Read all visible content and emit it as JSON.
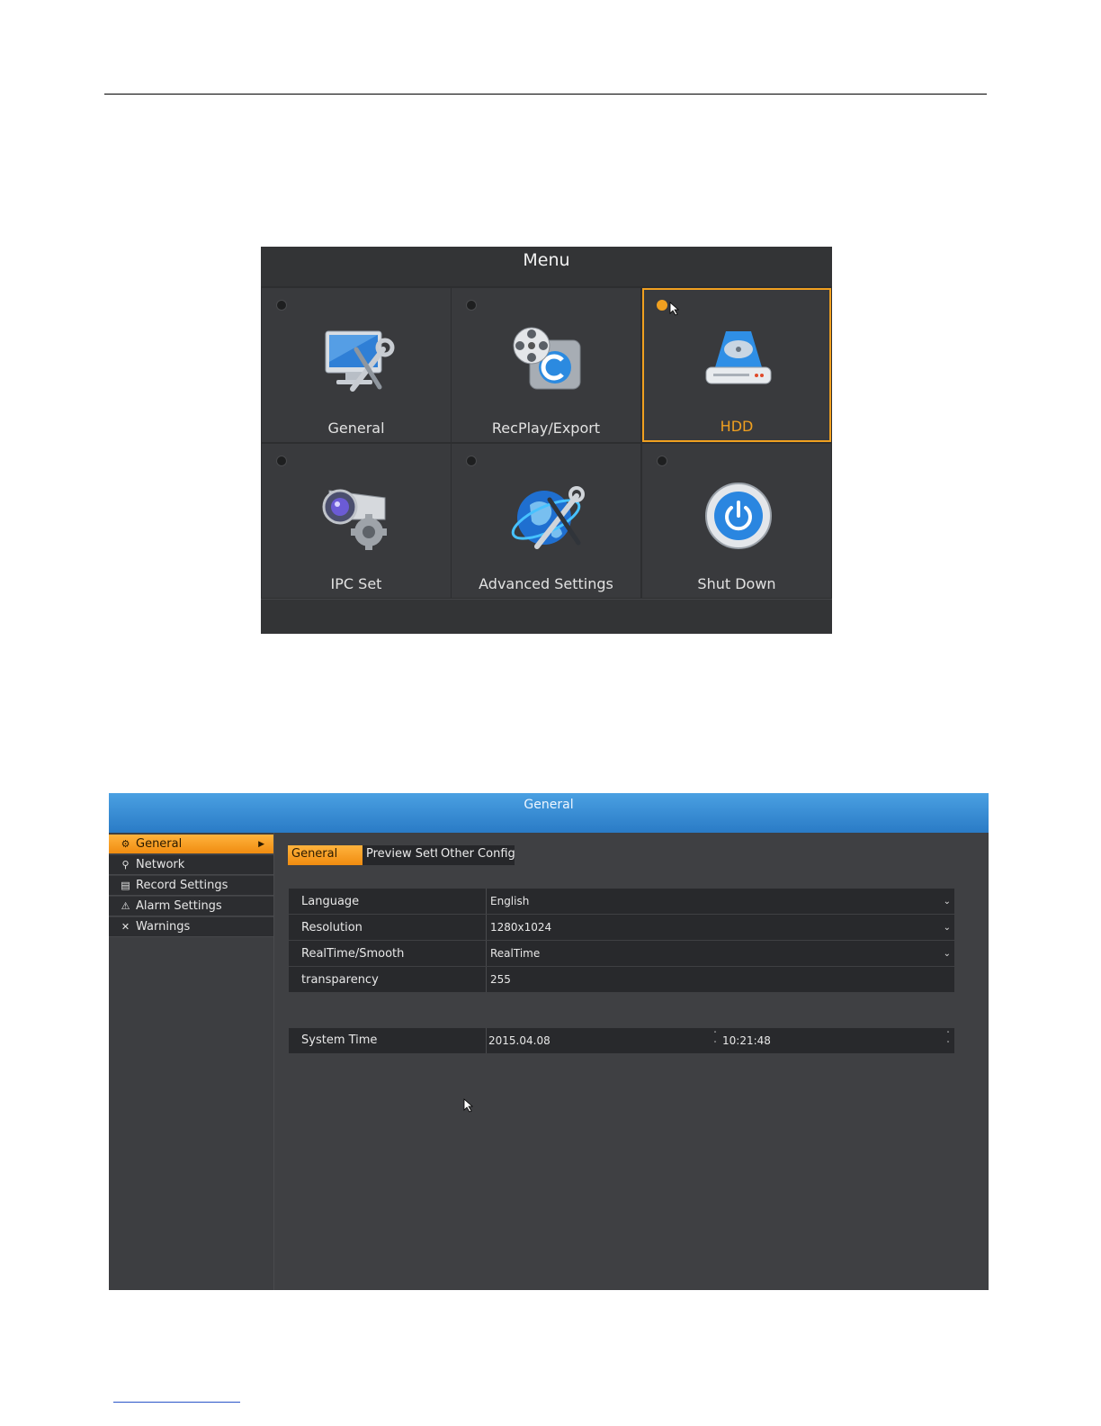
{
  "menu": {
    "title": "Menu",
    "tiles": [
      {
        "label": "General",
        "icon": "monitor-tools-icon"
      },
      {
        "label": "RecPlay/Export",
        "icon": "film-reel-icon"
      },
      {
        "label": "HDD",
        "icon": "hard-drive-icon",
        "selected": true
      },
      {
        "label": "IPC Set",
        "icon": "camera-gear-icon"
      },
      {
        "label": "Advanced Settings",
        "icon": "globe-tools-icon"
      },
      {
        "label": "Shut Down",
        "icon": "power-icon"
      }
    ]
  },
  "general": {
    "title": "General",
    "sidebar": [
      {
        "label": "General",
        "icon": "gears-icon",
        "active": true
      },
      {
        "label": "Network",
        "icon": "network-icon"
      },
      {
        "label": "Record Settings",
        "icon": "film-icon"
      },
      {
        "label": "Alarm Settings",
        "icon": "warning-icon"
      },
      {
        "label": "Warnings",
        "icon": "tools-icon"
      }
    ],
    "tabs": {
      "active": "General",
      "preview": "Preview Settir",
      "other": "Other Config"
    },
    "fields": [
      {
        "label": "Language",
        "value": "English",
        "dropdown": true
      },
      {
        "label": "Resolution",
        "value": "1280x1024",
        "dropdown": true
      },
      {
        "label": "RealTime/Smooth",
        "value": "RealTime",
        "dropdown": true
      },
      {
        "label": "transparency",
        "value": "255",
        "dropdown": false
      }
    ],
    "system_time": {
      "label": "System Time",
      "date": "2015.04.08",
      "time": "10:21:48"
    }
  },
  "colors": {
    "accent": "#f0a020",
    "header_blue": "#2a7bc6",
    "panel": "#393a3d"
  }
}
